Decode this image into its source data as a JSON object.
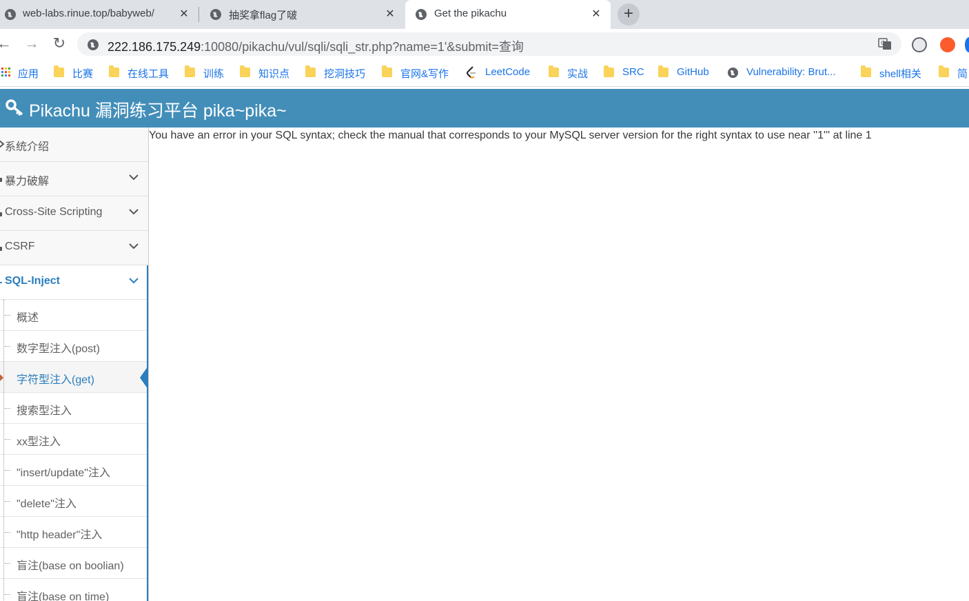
{
  "tabs": [
    {
      "title": "web-labs.rinue.top/babyweb/",
      "close": "✕"
    },
    {
      "title": "抽奖拿flag了啵",
      "close": "✕"
    },
    {
      "title": "Get the pikachu",
      "close": "✕"
    }
  ],
  "new_tab": "+",
  "toolbar": {
    "back": "←",
    "forward": "→",
    "reload": "↻",
    "url_host": "222.186.175.249",
    "url_path": ":10080/pikachu/vul/sqli/sqli_str.php?name=1'&submit=查询"
  },
  "bookmarks": [
    {
      "label": "应用",
      "icon": "apps-grid-icon"
    },
    {
      "label": "比赛",
      "icon": "folder-icon"
    },
    {
      "label": "在线工具",
      "icon": "folder-icon"
    },
    {
      "label": "训练",
      "icon": "folder-icon"
    },
    {
      "label": "知识点",
      "icon": "folder-icon"
    },
    {
      "label": "挖洞技巧",
      "icon": "folder-icon"
    },
    {
      "label": "官网&写作",
      "icon": "folder-icon"
    },
    {
      "label": "LeetCode",
      "icon": "leetcode-icon"
    },
    {
      "label": "实战",
      "icon": "folder-icon"
    },
    {
      "label": "SRC",
      "icon": "folder-icon"
    },
    {
      "label": "GitHub",
      "icon": "folder-icon"
    },
    {
      "label": "Vulnerability: Brut...",
      "icon": "globe-icon"
    },
    {
      "label": "shell相关",
      "icon": "folder-icon"
    },
    {
      "label": "简",
      "icon": "folder-icon"
    }
  ],
  "header": {
    "title": "Pikachu 漏洞练习平台 pika~pika~"
  },
  "sidebar": {
    "menu": [
      {
        "label": "系统介绍"
      },
      {
        "label": "暴力破解"
      },
      {
        "label": "Cross-Site Scripting"
      },
      {
        "label": "CSRF"
      },
      {
        "label": "SQL-Inject"
      }
    ],
    "submenu": [
      {
        "label": "概述"
      },
      {
        "label": "数字型注入(post)"
      },
      {
        "label": "字符型注入(get)"
      },
      {
        "label": "搜索型注入"
      },
      {
        "label": "xx型注入"
      },
      {
        "label": "\"insert/update\"注入"
      },
      {
        "label": "\"delete\"注入"
      },
      {
        "label": "\"http header\"注入"
      },
      {
        "label": "盲注(base on boolian)"
      },
      {
        "label": "盲注(base on time)"
      }
    ]
  },
  "content": {
    "error": "You have an error in your SQL syntax; check the manual that corresponds to your MySQL server version for the right syntax to use near ''1''' at line 1"
  },
  "colors": {
    "header_bg": "#438eb9",
    "accent": "#2b7dbc",
    "link": "#1a73e8"
  }
}
